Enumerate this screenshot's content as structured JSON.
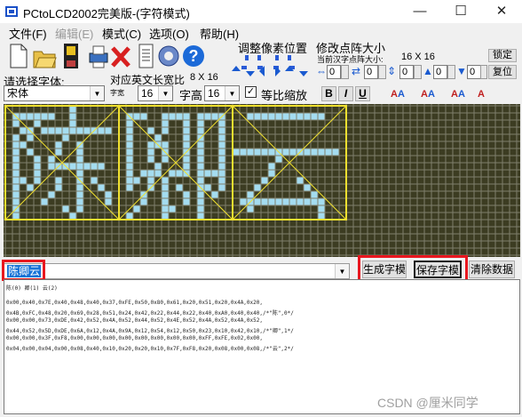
{
  "window": {
    "title": "PCtoLCD2002完美版-(字符模式)",
    "minimize": "—",
    "maximize": "☐",
    "close": "✕"
  },
  "menu": [
    {
      "label": "文件(F)"
    },
    {
      "label": "编辑(E)"
    },
    {
      "label": "模式(C)"
    },
    {
      "label": "选项(O)"
    },
    {
      "label": "帮助(H)"
    }
  ],
  "toolbar": {
    "icons": [
      "new-file-icon",
      "open-folder-icon",
      "save-disk-icon",
      "printer-icon",
      "delete-x-icon",
      "document-icon",
      "settings-gear-icon",
      "help-question-icon"
    ]
  },
  "pixel_adjust": {
    "label": "调整像素位置"
  },
  "dot_matrix": {
    "label": "修改点阵大小",
    "current_label": "当前汉字点阵大小:",
    "current_value": "16 X 16",
    "lock_label": "锁定",
    "restore_label": "复位",
    "spin_values": [
      "0",
      "0",
      "0",
      "0",
      "0"
    ]
  },
  "font": {
    "select_label": "请选择字体:",
    "name": "宋体",
    "width_label": "对应英文长宽比",
    "width_value": "8 X 16",
    "char_width_label": "字宽",
    "char_width": "16",
    "char_height_label": "字高",
    "char_height": "16",
    "proportional_label": "等比缩放",
    "proportional_checked": "✓",
    "bold": "B",
    "italic": "I",
    "underline": "U"
  },
  "input": {
    "text": "陈卿云"
  },
  "buttons": {
    "generate": "生成字模",
    "save": "保存字模",
    "clear": "清除数据"
  },
  "output": {
    "header": "陈(0) 卿(1) 云(2)",
    "lines": [
      "0x00,0x40,0x7E,0x40,0x48,0x40,0x37,0xFE,0x50,0x80,0x61,0x20,0x51,0x20,0x4A,0x20,",
      "0x4B,0xFC,0x48,0x20,0x69,0x28,0x51,0x24,0x42,0x22,0x44,0x22,0x40,0xA0,0x40,0x40,/*\"陈\",0*/",
      "0x00,0x00,0x73,0xDE,0x42,0x52,0x4A,0x52,0x44,0x52,0x4E,0x52,0x4A,0x52,0x4A,0x52,",
      "0x44,0x52,0x5D,0xDE,0x6A,0x12,0x4A,0x9A,0x12,0x54,0x12,0x50,0x23,0x10,0x42,0x10,/*\"卿\",1*/",
      "0x00,0x00,0x3F,0xF8,0x00,0x00,0x00,0x00,0x00,0x00,0x00,0x00,0xFF,0xFE,0x02,0x00,",
      "0x04,0x00,0x04,0x00,0x08,0x40,0x10,0x20,0x20,0x10,0x7F,0xF8,0x20,0x08,0x00,0x08,/*\"云\",2*/"
    ]
  },
  "watermark": "CSDN @厘米同学",
  "colors": {
    "grid_bg": "#3c3c22",
    "grid_line": "#7f7f6c",
    "lit_pixel": "#a4dcf0",
    "char_frame": "#f0e030",
    "highlight_box": "#e8171f"
  }
}
